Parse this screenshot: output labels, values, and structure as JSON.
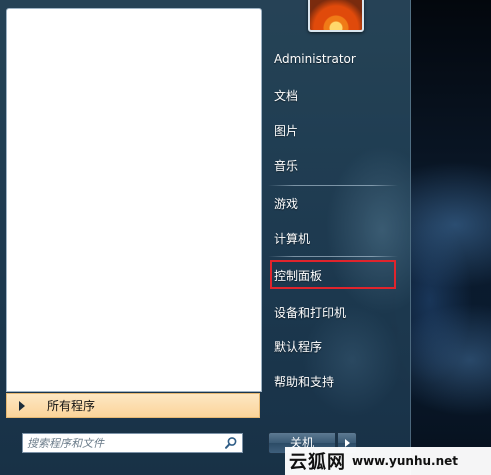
{
  "user": {
    "name": "Administrator"
  },
  "right_menu": {
    "items": [
      {
        "label": "文档"
      },
      {
        "label": "图片"
      },
      {
        "label": "音乐"
      },
      {
        "label": "游戏"
      },
      {
        "label": "计算机"
      },
      {
        "label": "控制面板",
        "highlighted": true
      },
      {
        "label": "设备和打印机"
      },
      {
        "label": "默认程序"
      },
      {
        "label": "帮助和支持"
      }
    ],
    "highlight_color": "#e0242c"
  },
  "left_panel": {
    "all_programs_label": "所有程序"
  },
  "search": {
    "placeholder": "搜索程序和文件",
    "icon": "search-icon"
  },
  "shutdown": {
    "label": "关机",
    "arrow_icon": "triangle-right-icon"
  },
  "watermark": {
    "brand": "云狐网",
    "url": "www.yunhu.net"
  }
}
